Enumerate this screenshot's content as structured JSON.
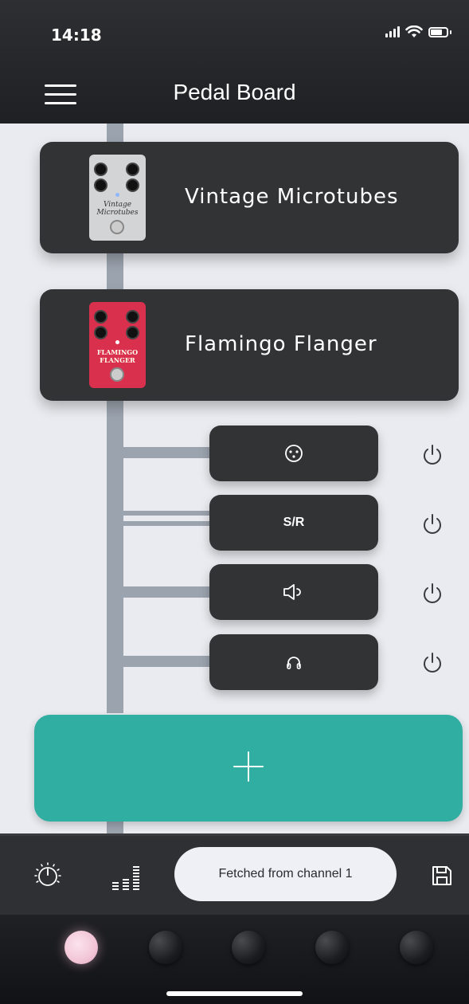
{
  "status_bar": {
    "time": "14:18"
  },
  "header": {
    "title": "Pedal Board"
  },
  "pedals": [
    {
      "name": "Vintage Microtubes",
      "image_brand": "Vintage Microtubes",
      "body_color": "#d3d4d6",
      "led_color": "#8fb8ff"
    },
    {
      "name": "Flamingo Flanger",
      "image_brand": "FLAMINGO FLANGER",
      "body_color": "#d9304e",
      "led_color": "#ffffff"
    }
  ],
  "outputs": [
    {
      "name": "xlr-output",
      "icon": "xlr-connector-icon",
      "label": ""
    },
    {
      "name": "send-return-output",
      "icon": "",
      "label": "S/R"
    },
    {
      "name": "speaker-output",
      "icon": "speaker-icon",
      "label": ""
    },
    {
      "name": "headphones-output",
      "icon": "headphones-icon",
      "label": ""
    }
  ],
  "add_button": {
    "icon": "plus-icon"
  },
  "toolbar": {
    "tune_icon": "knob-icon",
    "eq_icon": "level-meter-icon",
    "status_text": "Fetched from channel 1",
    "save_icon": "save-icon"
  },
  "presets": {
    "count": 5,
    "active_index": 0
  },
  "colors": {
    "accent": "#30aea1",
    "card": "#323335",
    "background": "#e9ebf0",
    "line": "#9ba3ae"
  }
}
